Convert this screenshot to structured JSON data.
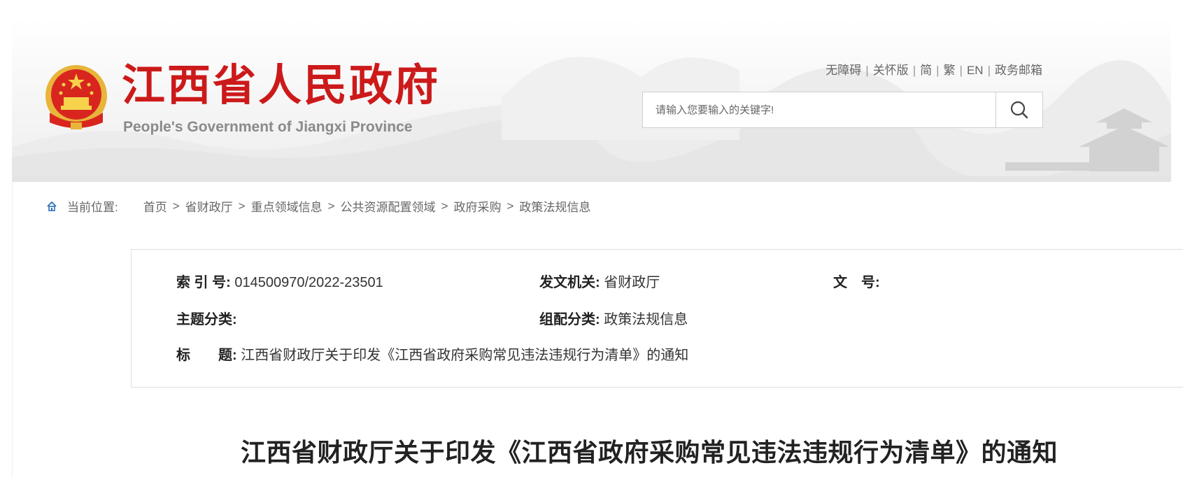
{
  "header": {
    "title": "江西省人民政府",
    "subtitle": "People's Government of Jiangxi Province",
    "links": [
      "无障碍",
      "关怀版",
      "简",
      "繁",
      "EN",
      "政务邮箱"
    ],
    "search_placeholder": "请输入您要输入的关键字!",
    "colors": {
      "brand_red": "#cc1a1a"
    }
  },
  "breadcrumb": {
    "label": "当前位置:",
    "items": [
      "首页",
      "省财政厅",
      "重点领域信息",
      "公共资源配置领域",
      "政府采购",
      "政策法规信息"
    ]
  },
  "info": {
    "index_label": "索 引 号:",
    "index_value": "014500970/2022-23501",
    "issuer_label": "发文机关:",
    "issuer_value": "省财政厅",
    "docno_label": "文　号:",
    "docno_value": "",
    "topic_label": "主题分类:",
    "topic_value": "",
    "category_label": "组配分类:",
    "category_value": "政策法规信息",
    "title_label": "标　　题:",
    "title_value": "江西省财政厅关于印发《江西省政府采购常见违法违规行为清单》的通知"
  },
  "article": {
    "title": "江西省财政厅关于印发《江西省政府采购常见违法违规行为清单》的通知"
  }
}
